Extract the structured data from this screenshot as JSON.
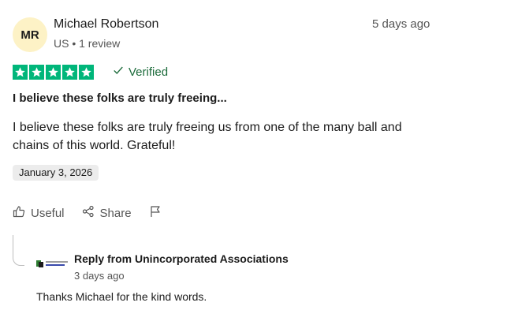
{
  "reviewer": {
    "initials": "MR",
    "name": "Michael Robertson",
    "meta": "US • 1 review",
    "review_date": "5 days ago"
  },
  "rating": {
    "stars": 5,
    "max": 5,
    "color": "#00b67a"
  },
  "verified_label": "Verified",
  "review": {
    "title": "I believe these folks are truly freeing...",
    "body": "I believe these folks are truly freeing us from one of the many ball and chains of this world. Grateful!",
    "experience_date": "January 3, 2026"
  },
  "actions": {
    "useful_label": "Useful",
    "share_label": "Share",
    "useful_icon": "thumbs-up-icon",
    "share_icon": "share-icon",
    "flag_icon": "flag-icon"
  },
  "reply": {
    "from_label": "Reply from Unincorporated Associations",
    "date": "3 days ago",
    "text": "Thanks Michael for the kind words."
  }
}
